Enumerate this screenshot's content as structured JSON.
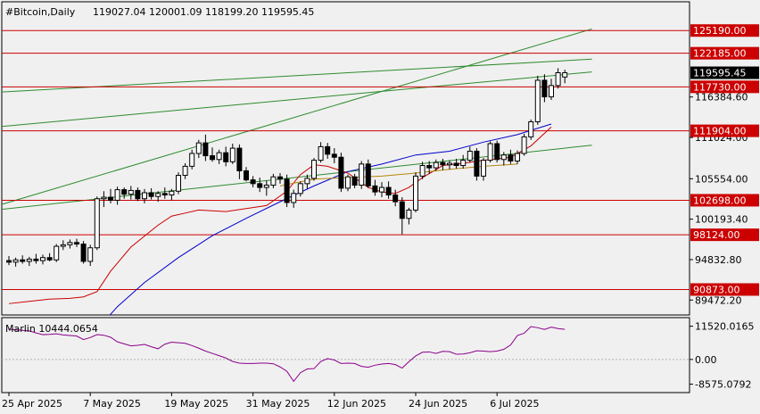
{
  "header": {
    "symbol": "#Bitcoin,Daily",
    "ohlc": "119027.04 120001.09 118199.20 119595.45"
  },
  "osc_header": "Marlin 10444.0654",
  "colors": {
    "background": "#f0f0f0",
    "bull_candle": "#ffffff",
    "bear_candle": "#000000",
    "level_line": "#cc0000",
    "channel_line": "#2e8b2e",
    "ma_blue": "#0000cc",
    "ma_red": "#cc0000",
    "ma_gold": "#b8860b",
    "oscillator": "#8b008b",
    "current_price_box": "#000000"
  },
  "chart_data": {
    "type": "candlestick",
    "ylim": [
      87500,
      129000
    ],
    "current_price": "119595.45",
    "price_levels": [
      {
        "value": 125190,
        "label": "125190.00"
      },
      {
        "value": 122185,
        "label": "122185.00"
      },
      {
        "value": 117730,
        "label": "117730.00"
      },
      {
        "value": 111904,
        "label": "111904.00"
      },
      {
        "value": 102698,
        "label": "102698.00"
      },
      {
        "value": 98124,
        "label": "98124.00"
      },
      {
        "value": 90873,
        "label": "90873.00"
      }
    ],
    "y_ticks": [
      {
        "value": 116384.6,
        "label": "116384.60"
      },
      {
        "value": 111024,
        "label": "111024.00"
      },
      {
        "value": 105554,
        "label": "105554.00"
      },
      {
        "value": 100193.4,
        "label": "100193.40"
      },
      {
        "value": 94832.8,
        "label": "94832.80"
      },
      {
        "value": 89472.2,
        "label": "89472.20"
      }
    ],
    "x_labels": [
      {
        "index": 0,
        "label": "25 Apr 2025"
      },
      {
        "index": 12,
        "label": "7 May 2025"
      },
      {
        "index": 24,
        "label": "19 May 2025"
      },
      {
        "index": 36,
        "label": "31 May 2025"
      },
      {
        "index": 48,
        "label": "12 Jun 2025"
      },
      {
        "index": 60,
        "label": "24 Jun 2025"
      },
      {
        "index": 72,
        "label": "6 Jul 2025"
      }
    ],
    "candles": [
      [
        94700,
        95300,
        94100,
        94500
      ],
      [
        94500,
        95100,
        93900,
        94800
      ],
      [
        94800,
        95400,
        94300,
        94600
      ],
      [
        94600,
        95200,
        94000,
        94900
      ],
      [
        94900,
        95600,
        94300,
        94700
      ],
      [
        94700,
        95500,
        94200,
        95100
      ],
      [
        95100,
        95700,
        94600,
        94800
      ],
      [
        94800,
        96900,
        94500,
        96600
      ],
      [
        96600,
        97400,
        96100,
        96800
      ],
      [
        96800,
        97500,
        96300,
        97100
      ],
      [
        97100,
        97600,
        96500,
        96900
      ],
      [
        96900,
        97300,
        94300,
        94600
      ],
      [
        94600,
        96800,
        94000,
        96400
      ],
      [
        96400,
        103200,
        96100,
        102900
      ],
      [
        102900,
        103900,
        101800,
        103100
      ],
      [
        103100,
        104200,
        102300,
        102700
      ],
      [
        102700,
        104500,
        102100,
        104100
      ],
      [
        104100,
        104400,
        102900,
        103500
      ],
      [
        103500,
        104600,
        102800,
        104000
      ],
      [
        104000,
        104400,
        102600,
        102900
      ],
      [
        102900,
        104200,
        102300,
        103700
      ],
      [
        103700,
        104300,
        102800,
        103200
      ],
      [
        103200,
        103900,
        102500,
        103600
      ],
      [
        103600,
        104400,
        102900,
        103400
      ],
      [
        103400,
        104200,
        102700,
        103900
      ],
      [
        103900,
        106400,
        103500,
        106000
      ],
      [
        106000,
        107600,
        105500,
        107200
      ],
      [
        107200,
        109400,
        106800,
        108900
      ],
      [
        108900,
        110700,
        108300,
        110300
      ],
      [
        110300,
        111400,
        107900,
        108600
      ],
      [
        108600,
        109700,
        107800,
        108100
      ],
      [
        108100,
        109400,
        107500,
        109000
      ],
      [
        109000,
        109800,
        107200,
        107800
      ],
      [
        107800,
        110200,
        107500,
        109600
      ],
      [
        109600,
        110100,
        105500,
        106600
      ],
      [
        106600,
        107100,
        105200,
        105400
      ],
      [
        105400,
        105900,
        104400,
        104900
      ],
      [
        104900,
        105700,
        103800,
        104400
      ],
      [
        104400,
        105300,
        103300,
        104700
      ],
      [
        104700,
        106200,
        104300,
        105800
      ],
      [
        105800,
        106300,
        104900,
        105500
      ],
      [
        105500,
        106100,
        101800,
        102400
      ],
      [
        102400,
        104100,
        101700,
        103600
      ],
      [
        103600,
        105200,
        103200,
        104900
      ],
      [
        104900,
        106100,
        104200,
        105600
      ],
      [
        105600,
        108300,
        105300,
        108000
      ],
      [
        108000,
        110400,
        107700,
        109800
      ],
      [
        109800,
        110300,
        108200,
        108800
      ],
      [
        108800,
        109600,
        107600,
        108400
      ],
      [
        108400,
        109000,
        103800,
        104300
      ],
      [
        104300,
        106100,
        103900,
        105800
      ],
      [
        105800,
        106200,
        104300,
        104700
      ],
      [
        104700,
        107900,
        104200,
        107500
      ],
      [
        107500,
        108100,
        104300,
        104600
      ],
      [
        104600,
        105400,
        103300,
        103800
      ],
      [
        103800,
        105100,
        103100,
        104400
      ],
      [
        104400,
        105200,
        102900,
        103400
      ],
      [
        103400,
        104100,
        101900,
        102500
      ],
      [
        102500,
        103100,
        98200,
        100300
      ],
      [
        100300,
        101700,
        99500,
        101400
      ],
      [
        101400,
        106400,
        101100,
        105900
      ],
      [
        105900,
        107800,
        105500,
        107300
      ],
      [
        107300,
        107900,
        106200,
        107000
      ],
      [
        107000,
        108100,
        106600,
        107700
      ],
      [
        107700,
        108200,
        106700,
        107400
      ],
      [
        107400,
        108000,
        106800,
        107600
      ],
      [
        107600,
        108200,
        106900,
        107300
      ],
      [
        107300,
        108700,
        106900,
        108000
      ],
      [
        108000,
        109800,
        107700,
        109200
      ],
      [
        109200,
        109600,
        105300,
        105900
      ],
      [
        105900,
        108300,
        105300,
        108000
      ],
      [
        108000,
        110500,
        107700,
        110200
      ],
      [
        110200,
        110600,
        107700,
        108100
      ],
      [
        108100,
        109100,
        107300,
        108700
      ],
      [
        108700,
        109400,
        107500,
        107900
      ],
      [
        107900,
        109300,
        107500,
        108900
      ],
      [
        108900,
        111500,
        108600,
        111100
      ],
      [
        111100,
        113400,
        110700,
        113100
      ],
      [
        113100,
        119200,
        112700,
        118600
      ],
      [
        118600,
        119400,
        115700,
        116400
      ],
      [
        116400,
        118800,
        116000,
        117900
      ],
      [
        117900,
        120200,
        117500,
        119600
      ],
      [
        119027,
        120001,
        118199,
        119595
      ]
    ],
    "ma_blue": [
      [
        13,
        85600
      ],
      [
        16,
        88600
      ],
      [
        20,
        91800
      ],
      [
        25,
        95100
      ],
      [
        30,
        98000
      ],
      [
        35,
        100300
      ],
      [
        40,
        102500
      ],
      [
        45,
        104600
      ],
      [
        50,
        106500
      ],
      [
        55,
        107500
      ],
      [
        60,
        108700
      ],
      [
        65,
        109200
      ],
      [
        70,
        110400
      ],
      [
        75,
        111400
      ],
      [
        80,
        112800
      ]
    ],
    "ma_red": [
      [
        0,
        89000
      ],
      [
        3,
        89300
      ],
      [
        6,
        89600
      ],
      [
        9,
        89700
      ],
      [
        11,
        89900
      ],
      [
        13,
        90600
      ],
      [
        15,
        93300
      ],
      [
        18,
        96500
      ],
      [
        22,
        99400
      ],
      [
        24,
        100600
      ],
      [
        26,
        101000
      ],
      [
        28,
        101400
      ],
      [
        32,
        101200
      ],
      [
        35,
        101600
      ],
      [
        38,
        102000
      ],
      [
        41,
        103900
      ],
      [
        43,
        106100
      ],
      [
        45,
        107400
      ],
      [
        47,
        107200
      ],
      [
        50,
        106300
      ],
      [
        53,
        104400
      ],
      [
        55,
        103800
      ],
      [
        57,
        103600
      ],
      [
        59,
        104400
      ],
      [
        61,
        105700
      ],
      [
        64,
        107300
      ],
      [
        67,
        107600
      ],
      [
        70,
        108000
      ],
      [
        74,
        108400
      ],
      [
        77,
        109900
      ],
      [
        80,
        112400
      ]
    ],
    "ma_gold": [
      [
        40,
        104600
      ],
      [
        45,
        105500
      ],
      [
        50,
        105700
      ],
      [
        55,
        105900
      ],
      [
        60,
        106300
      ],
      [
        65,
        106800
      ],
      [
        70,
        107200
      ],
      [
        75,
        107500
      ]
    ],
    "channel_lines": [
      [
        [
          -2,
          101900
        ],
        [
          86,
          125400
        ]
      ],
      [
        [
          -2,
          117000
        ],
        [
          86,
          121400
        ]
      ],
      [
        [
          -2,
          112400
        ],
        [
          86,
          119700
        ]
      ],
      [
        [
          -2,
          101400
        ],
        [
          86,
          110000
        ]
      ]
    ],
    "oscillator": {
      "name": "Marlin",
      "value": "10444.0654",
      "ylim": [
        -11500,
        14500
      ],
      "ticks": [
        {
          "value": 11520.0165,
          "label": "11520.0165"
        },
        {
          "value": 0,
          "label": "0.00"
        },
        {
          "value": -8575.0792,
          "label": "-8575.0792"
        }
      ],
      "values": [
        10500,
        10300,
        10100,
        9900,
        9200,
        8600,
        8700,
        8900,
        8500,
        8300,
        8100,
        6900,
        7600,
        8600,
        8400,
        7700,
        6100,
        5400,
        4700,
        4900,
        5200,
        4400,
        3700,
        5300,
        6000,
        5800,
        5600,
        4800,
        3900,
        2900,
        2100,
        1300,
        500,
        -700,
        -1300,
        -1400,
        -1400,
        -1300,
        -1300,
        -1500,
        -2600,
        -4100,
        -7600,
        -4600,
        -3300,
        -3200,
        -700,
        300,
        -200,
        -1400,
        -1300,
        -1400,
        -2400,
        -2700,
        -2000,
        -1600,
        -1400,
        -1800,
        -3000,
        -800,
        1200,
        2500,
        2600,
        2100,
        2800,
        2700,
        1800,
        1900,
        2300,
        3000,
        2900,
        2700,
        2900,
        3500,
        5000,
        8300,
        9100,
        11400,
        11000,
        10400,
        11200,
        10700,
        10444
      ]
    }
  }
}
